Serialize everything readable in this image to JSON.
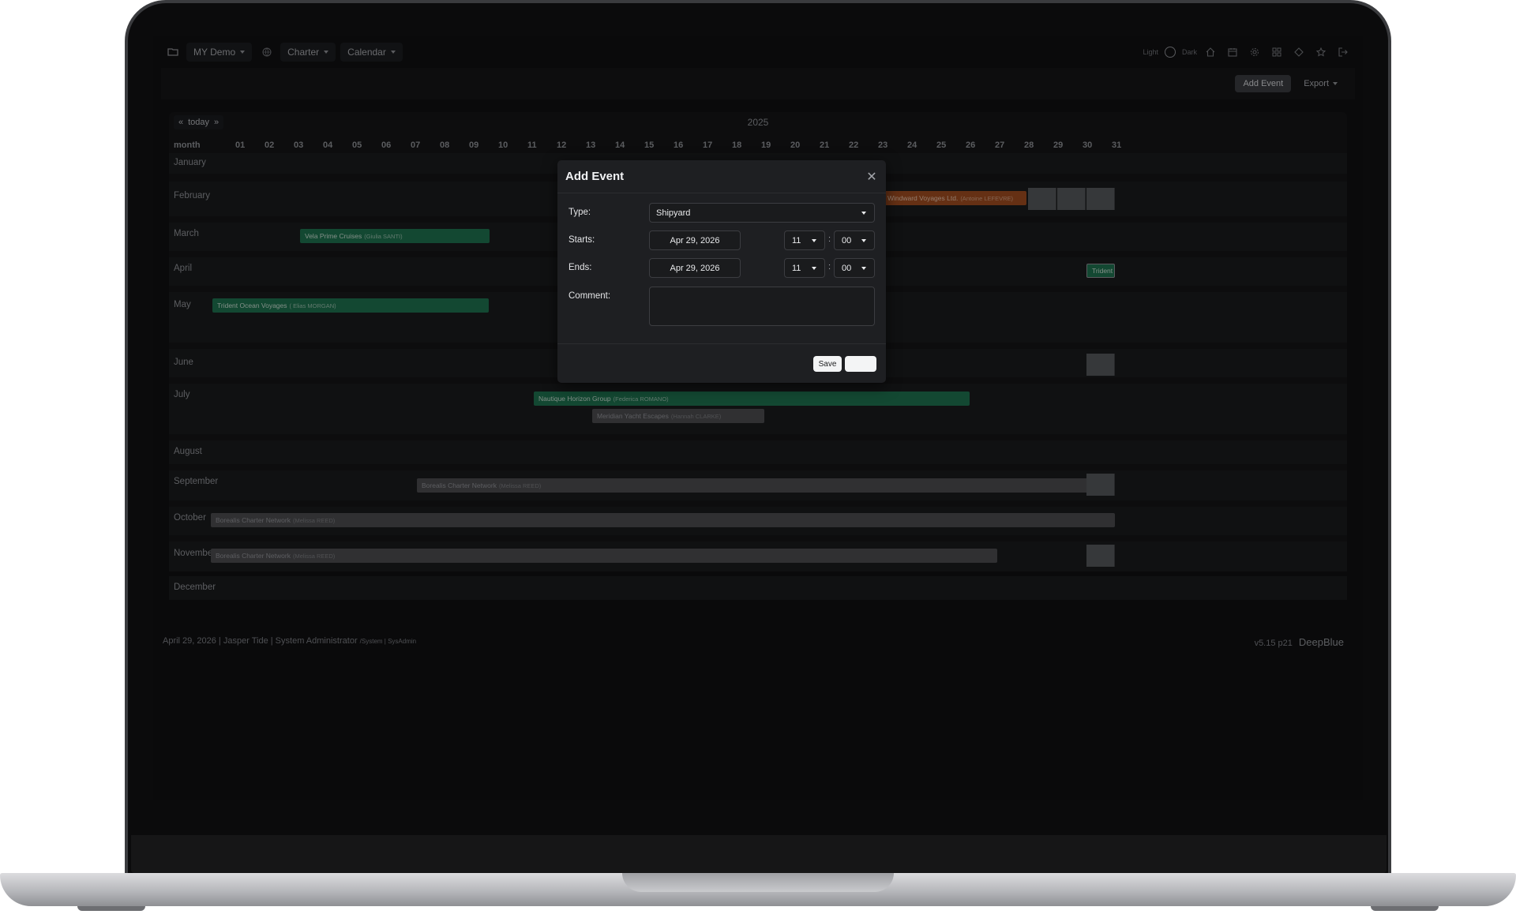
{
  "nav": {
    "workspace": "MY Demo",
    "module": "Charter",
    "view": "Calendar"
  },
  "theme": {
    "light_label": "Light",
    "dark_label": "Dark"
  },
  "toolbar": {
    "add_event": "Add Event",
    "export": "Export"
  },
  "calendar": {
    "today": "today",
    "year": "2025",
    "month_header": "month",
    "days": [
      "01",
      "02",
      "03",
      "04",
      "05",
      "06",
      "07",
      "08",
      "09",
      "10",
      "11",
      "12",
      "13",
      "14",
      "15",
      "16",
      "17",
      "18",
      "19",
      "20",
      "21",
      "22",
      "23",
      "24",
      "25",
      "26",
      "27",
      "28",
      "29",
      "30",
      "31"
    ],
    "months": [
      "January",
      "February",
      "March",
      "April",
      "May",
      "June",
      "July",
      "August",
      "September",
      "October",
      "November",
      "December"
    ],
    "events": [
      {
        "company": "Windward Voyages Ltd.",
        "person": "(Antoine LEFEVRE)",
        "color": "#9c4b1f"
      },
      {
        "company": "Vela Prime Cruises",
        "person": "(Giulia SANTI)",
        "color": "#1e6f4d"
      },
      {
        "company": "Trident Ocean Voyages",
        "person": "( Elias MORGAN)",
        "color": "#1e6f4d"
      },
      {
        "company": "Trident",
        "person": "",
        "color": "#1e6f4d"
      },
      {
        "company": "Nautique Horizon Group",
        "person": "(Federica ROMANO)",
        "color": "#1e6f4d"
      },
      {
        "company": "Meridian Yacht Escapes",
        "person": "(Hannah CLARKE)",
        "color": "#4a4b4e"
      },
      {
        "company": "Borealis Charter Network",
        "person": "(Melissa REED)",
        "color": "#4a4b4e"
      },
      {
        "company": "Borealis Charter Network",
        "person": "(Melissa REED)",
        "color": "#4a4b4e"
      },
      {
        "company": "Borealis Charter Network",
        "person": "(Melissa REED)",
        "color": "#4a4b4e"
      }
    ]
  },
  "modal": {
    "title": "Add Event",
    "type_label": "Type:",
    "type_value": "Shipyard",
    "starts_label": "Starts:",
    "starts_date": "Apr 29, 2026",
    "starts_hour": "11",
    "starts_minute": "00",
    "ends_label": "Ends:",
    "ends_date": "Apr 29, 2026",
    "ends_hour": "11",
    "ends_minute": "00",
    "comment_label": "Comment:",
    "comment_value": "",
    "save": "Save"
  },
  "footer": {
    "status": "April 29, 2026 | Jasper Tide | System Administrator",
    "role": "/System | SysAdmin",
    "version": "v5.15 p21",
    "brand": "DeepBlue"
  }
}
